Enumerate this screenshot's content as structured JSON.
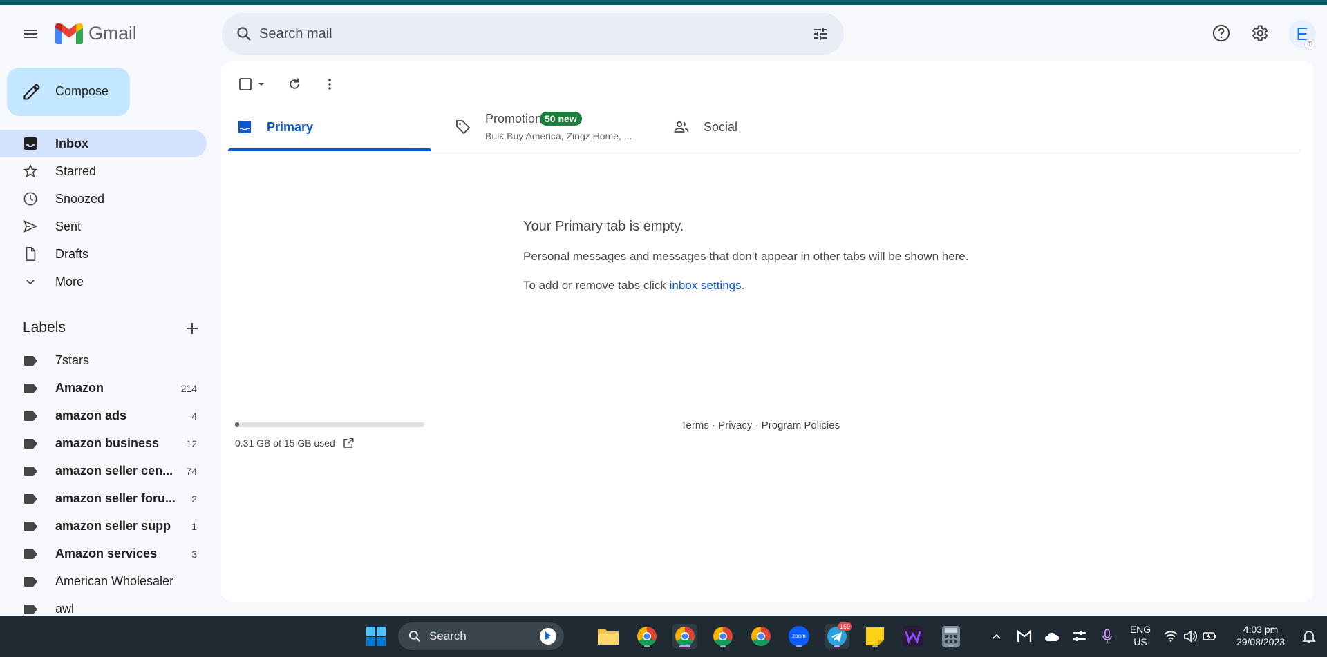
{
  "header": {
    "app_name": "Gmail",
    "search_placeholder": "Search mail",
    "avatar_initial": "E"
  },
  "sidebar": {
    "compose_label": "Compose",
    "nav": [
      {
        "label": "Inbox",
        "icon": "inbox-icon",
        "active": true
      },
      {
        "label": "Starred",
        "icon": "star-icon"
      },
      {
        "label": "Snoozed",
        "icon": "clock-icon"
      },
      {
        "label": "Sent",
        "icon": "send-icon"
      },
      {
        "label": "Drafts",
        "icon": "draft-icon"
      },
      {
        "label": "More",
        "icon": "chevron-down-icon"
      }
    ],
    "labels_title": "Labels",
    "labels": [
      {
        "name": "7stars",
        "count": ""
      },
      {
        "name": "Amazon",
        "count": "214"
      },
      {
        "name": "amazon ads",
        "count": "4"
      },
      {
        "name": "amazon business",
        "count": "12"
      },
      {
        "name": "amazon seller cen...",
        "count": "74"
      },
      {
        "name": "amazon seller foru...",
        "count": "2"
      },
      {
        "name": "amazon seller supp",
        "count": "1"
      },
      {
        "name": "Amazon services",
        "count": "3"
      },
      {
        "name": "American Wholesaler",
        "count": ""
      },
      {
        "name": "awl",
        "count": ""
      }
    ]
  },
  "tabs": {
    "primary": "Primary",
    "promotions": "Promotions",
    "promotions_badge": "50 new",
    "promotions_sub": "Bulk Buy America, Zingz Home, ...",
    "social": "Social"
  },
  "empty_state": {
    "title": "Your Primary tab is empty.",
    "line1": "Personal messages and messages that don’t appear in other tabs will be shown here.",
    "line2_prefix": "To add or remove tabs click ",
    "line2_link": "inbox settings",
    "line2_suffix": "."
  },
  "storage": {
    "text": "0.31 GB of 15 GB used",
    "fraction": 0.021
  },
  "footer": {
    "terms": "Terms",
    "privacy": "Privacy",
    "policies": "Program Policies",
    "sep": " · "
  },
  "taskbar": {
    "search_label": "Search",
    "lang_top": "ENG",
    "lang_bottom": "US",
    "time": "4:03 pm",
    "date": "29/08/2023",
    "telegram_badge": "159",
    "zoom_label": "zoom"
  },
  "colors": {
    "accent": "#0b57d0",
    "compose_bg": "#c2e7ff",
    "active_nav": "#d3e3fd",
    "badge_green": "#188038"
  }
}
